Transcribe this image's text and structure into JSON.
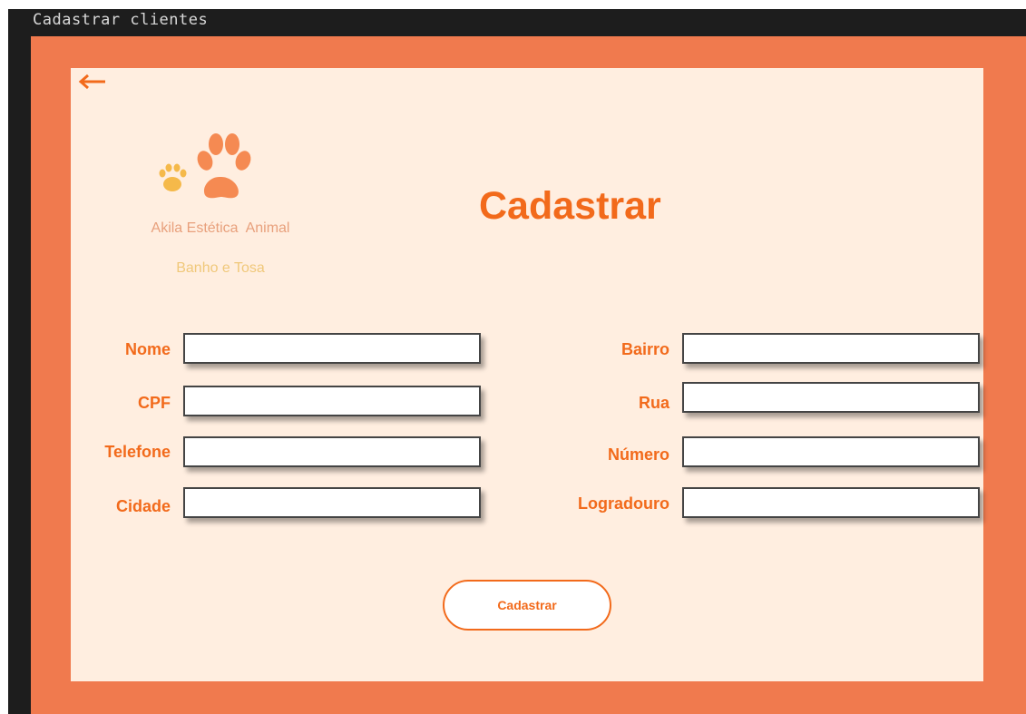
{
  "window": {
    "title": "Cadastrar clientes"
  },
  "brand": {
    "name": "Akila Estética  Animal",
    "subtitle": "Banho e Tosa"
  },
  "page": {
    "title": "Cadastrar"
  },
  "form": {
    "left": [
      {
        "label": "Nome",
        "value": ""
      },
      {
        "label": "CPF",
        "value": ""
      },
      {
        "label": "Telefone",
        "value": ""
      },
      {
        "label": "Cidade",
        "value": ""
      }
    ],
    "right": [
      {
        "label": "Bairro",
        "value": ""
      },
      {
        "label": "Rua",
        "value": ""
      },
      {
        "label": "Número",
        "value": ""
      },
      {
        "label": "Logradouro",
        "value": ""
      }
    ],
    "submit_label": "Cadastrar"
  },
  "icons": {
    "back": "arrow-left-icon",
    "logo": "paw-prints-icon"
  },
  "colors": {
    "accent": "#f26a1b",
    "frame": "#f07a4e",
    "panel": "#ffeee0",
    "titlebar": "#1d1d1d"
  }
}
